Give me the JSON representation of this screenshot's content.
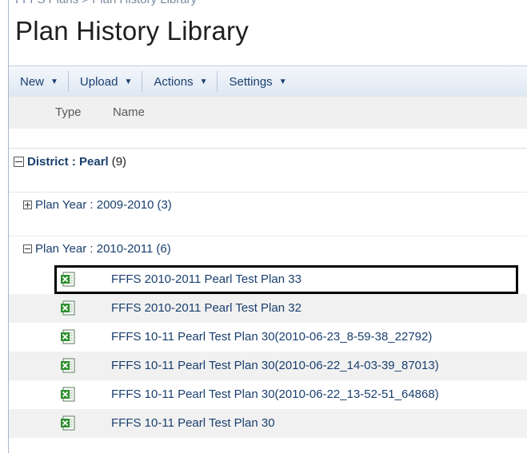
{
  "breadcrumb": {
    "text": "FFFS Plans > Plan History Library"
  },
  "page": {
    "title": "Plan History Library"
  },
  "toolbar": {
    "new_label": "New",
    "upload_label": "Upload",
    "actions_label": "Actions",
    "settings_label": "Settings"
  },
  "columns": {
    "type": "Type",
    "name": "Name"
  },
  "group": {
    "label": "District : Pearl",
    "count": "(9)"
  },
  "subgroups": [
    {
      "label": "Plan Year : 2009-2010",
      "count": "(3)",
      "expanded": false
    },
    {
      "label": "Plan Year : 2010-2011",
      "count": "(6)",
      "expanded": true
    }
  ],
  "items": [
    {
      "name": "FFFS 2010-2011 Pearl Test Plan 33",
      "icon": "excel-file-icon"
    },
    {
      "name": "FFFS 2010-2011 Pearl Test Plan 32",
      "icon": "excel-file-icon"
    },
    {
      "name": "FFFS 10-11 Pearl Test Plan 30(2010-06-23_8-59-38_22792)",
      "icon": "excel-file-icon"
    },
    {
      "name": "FFFS 10-11 Pearl Test Plan 30(2010-06-22_14-03-39_87013)",
      "icon": "excel-file-icon"
    },
    {
      "name": "FFFS 10-11 Pearl Test Plan 30(2010-06-22_13-52-51_64868)",
      "icon": "excel-file-icon"
    },
    {
      "name": "FFFS 10-11 Pearl Test Plan 30",
      "icon": "excel-file-icon"
    }
  ],
  "colors": {
    "link": "#1a3f6e",
    "toolbar_top": "#f4f7fb",
    "toolbar_bottom": "#dde7f3",
    "excel_green": "#2f8f2f"
  }
}
